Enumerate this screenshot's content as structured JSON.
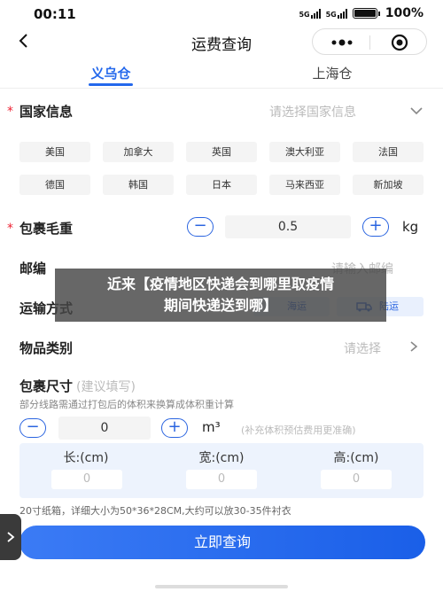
{
  "status_bar": {
    "time": "00:11",
    "signal1": "5G",
    "signal2": "5G",
    "battery": "100%"
  },
  "nav": {
    "title": "运费查询",
    "icons": [
      "back-icon",
      "more-icon",
      "close-icon"
    ]
  },
  "tabs": [
    {
      "label": "义乌仓",
      "active": true
    },
    {
      "label": "上海仓",
      "active": false
    }
  ],
  "country": {
    "label": "国家信息",
    "placeholder": "请选择国家信息",
    "options": [
      "美国",
      "加拿大",
      "英国",
      "澳大利亚",
      "法国",
      "德国",
      "韩国",
      "日本",
      "马来西亚",
      "新加坡"
    ]
  },
  "weight": {
    "label": "包裹毛重",
    "minus": "−",
    "value": "0.5",
    "plus": "+",
    "unit": "kg"
  },
  "postcode": {
    "label": "邮编",
    "placeholder": "请输入邮编"
  },
  "transport": {
    "label": "运输方式",
    "options": [
      "海运",
      "陆运"
    ]
  },
  "category": {
    "label": "物品类别",
    "placeholder": "请选择"
  },
  "size": {
    "label": "包裹尺寸",
    "label_hint": "(建议填写)",
    "note": "部分线路需通过打包后的体积来换算成体积重计算",
    "minus": "−",
    "value": "0",
    "plus": "+",
    "unit": "m³",
    "unit_hint": "(补充体积预估费用更准确)",
    "columns": [
      {
        "label": "长:(cm)",
        "value": "0"
      },
      {
        "label": "宽:(cm)",
        "value": "0"
      },
      {
        "label": "高:(cm)",
        "value": "0"
      }
    ],
    "footnote": "20寸纸箱，详细大小为50*36*28CM,大约可以放30-35件衬衣"
  },
  "submit_label": "立即查询",
  "side_tab_glyph": ">",
  "overlay": {
    "line1": "近来【疫情地区快递会到哪里取疫情",
    "line2": "期间快递送到哪】"
  },
  "colors": {
    "accent": "#2468ec",
    "required": "#e23333",
    "overlay": "#464646"
  }
}
